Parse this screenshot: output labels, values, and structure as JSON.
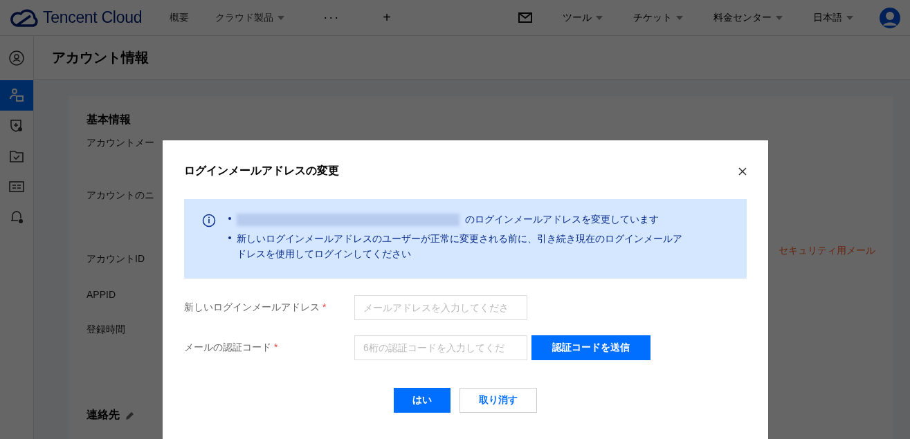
{
  "topbar": {
    "logo": "Tencent Cloud",
    "nav": [
      {
        "label": "概要",
        "has_menu": false
      },
      {
        "label": "クラウド製品",
        "has_menu": true
      }
    ],
    "more": "···",
    "add": "+",
    "right_menu": [
      {
        "label": "ツール",
        "has_menu": true
      },
      {
        "label": "チケット",
        "has_menu": true
      },
      {
        "label": "料金センター",
        "has_menu": true
      },
      {
        "label": "日本語",
        "has_menu": true
      }
    ]
  },
  "sidebar": {
    "items": [
      {
        "selected": false
      },
      {
        "selected": true
      },
      {
        "selected": false
      },
      {
        "selected": false
      },
      {
        "selected": false
      },
      {
        "selected": false
      }
    ]
  },
  "page": {
    "title": "アカウント情報",
    "section": "基本情報",
    "fields": [
      {
        "label": "アカウントメー"
      },
      {
        "label": "アカウントのニ"
      },
      {
        "label": "アカウントID",
        "note": "セキュリティ用メール"
      },
      {
        "label": "APPID"
      },
      {
        "label": "登録時間"
      }
    ],
    "contact_section": "連絡先"
  },
  "modal": {
    "title": "ログインメールアドレスの変更",
    "notice": [
      {
        "redacted_prefix": true,
        "text": "のログインメールアドレスを変更しています"
      },
      {
        "redacted_prefix": false,
        "text": "新しいログインメールアドレスのユーザーが正常に変更される前に、引き続き現在のログインメールアドレスを使用してログインしてください"
      }
    ],
    "form": [
      {
        "label": "新しいログインメールアドレス",
        "required_mark": "*",
        "placeholder": "メールアドレスを入力してくださ"
      },
      {
        "label": "メールの認証コード",
        "required_mark": "*",
        "placeholder": "6桁の認証コードを入力してくだ",
        "button": "認証コードを送信"
      }
    ],
    "buttons": [
      {
        "label": "はい",
        "kind": "primary"
      },
      {
        "label": "取り消す",
        "kind": "default"
      }
    ]
  }
}
